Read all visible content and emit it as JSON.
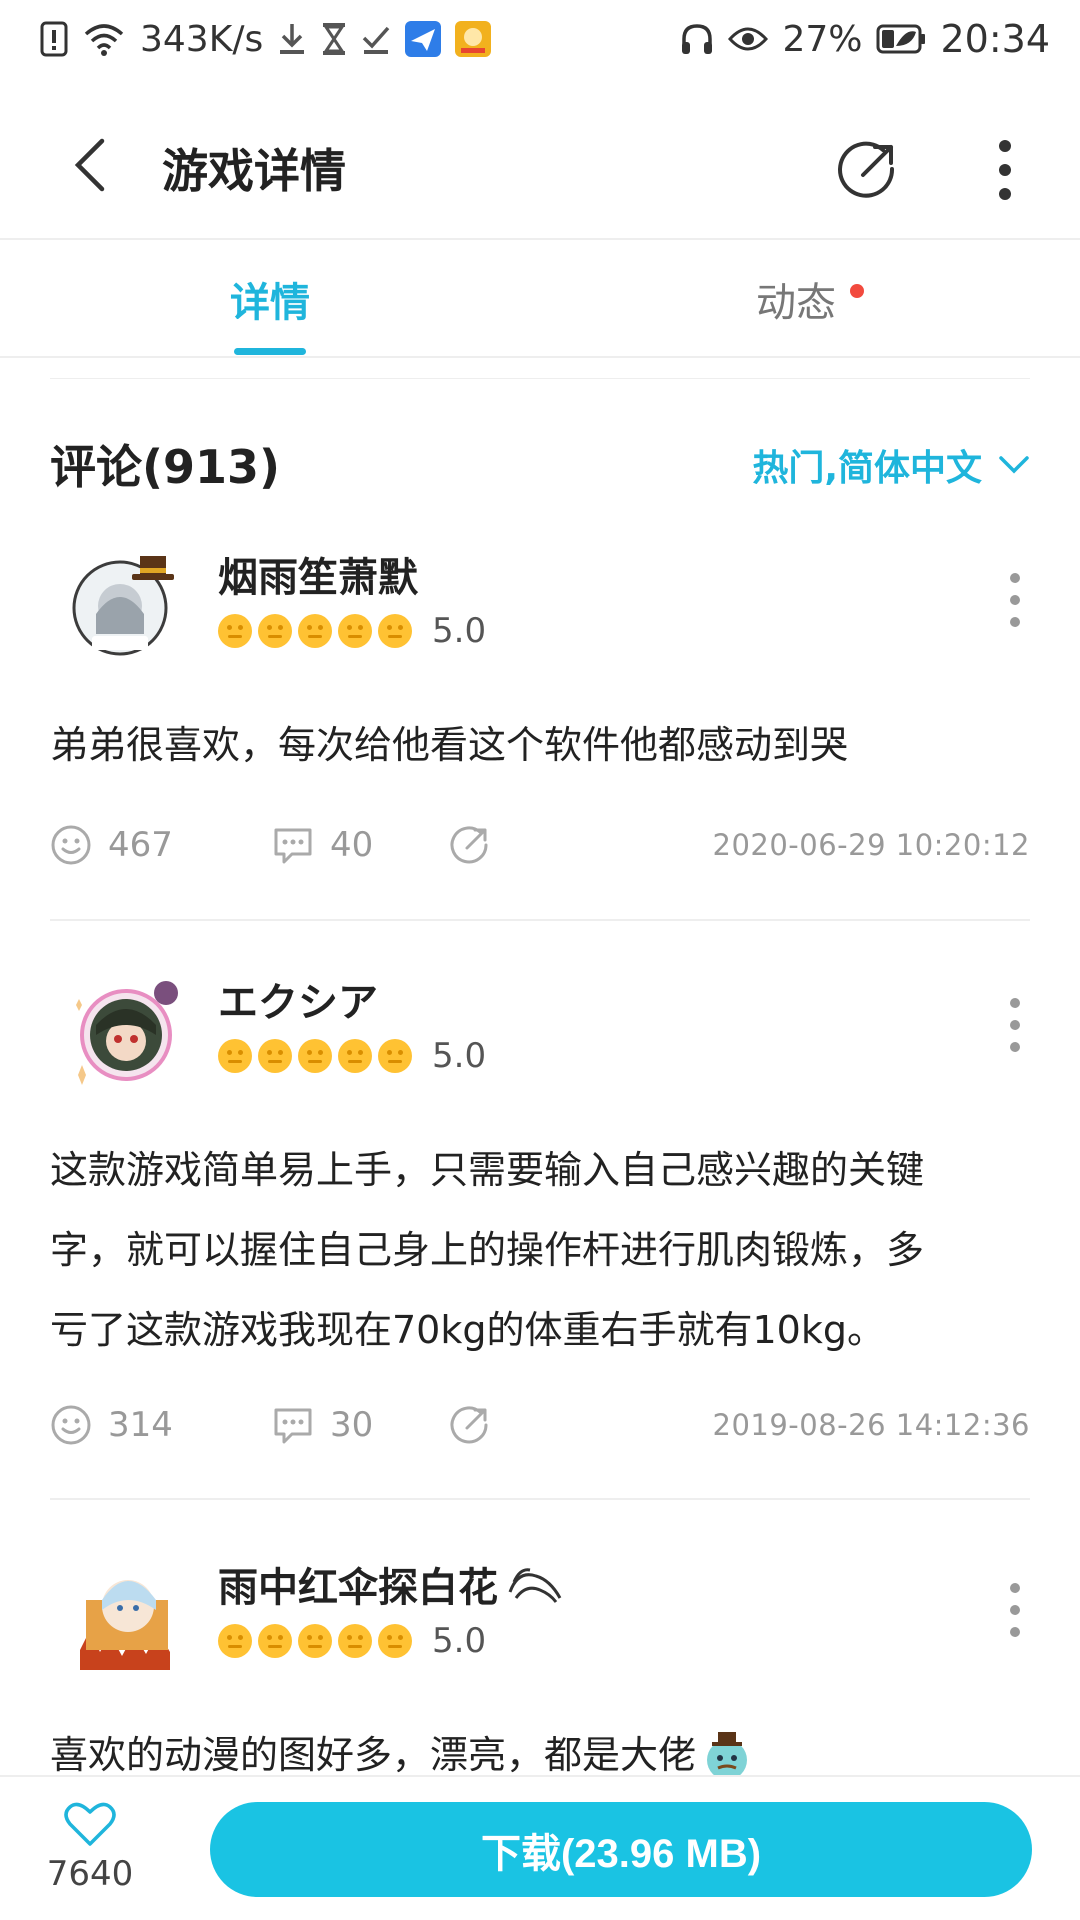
{
  "status_bar": {
    "network_speed": "343K/s",
    "battery": "27%",
    "time": "20:34"
  },
  "header": {
    "title": "游戏详情"
  },
  "tabs": [
    {
      "label": "详情",
      "active": true
    },
    {
      "label": "动态",
      "active": false,
      "has_dot": true
    }
  ],
  "comments": {
    "title": "评论(913)",
    "sort_label": "热门,简体中文",
    "items": [
      {
        "username": "烟雨笙萧默",
        "rating": "5.0",
        "content": [
          "弟弟很喜欢，每次给他看这个软件他都感动到哭"
        ],
        "likes": "467",
        "replies": "40",
        "timestamp": "2020-06-29 10:20:12"
      },
      {
        "username": "エクシア",
        "rating": "5.0",
        "content": [
          "这款游戏简单易上手，只需要输入自己感兴趣的关键",
          "字，就可以握住自己身上的操作杆进行肌肉锻炼，多",
          "亏了这款游戏我现在70kg的体重右手就有10kg。"
        ],
        "likes": "314",
        "replies": "30",
        "timestamp": "2019-08-26 14:12:36"
      },
      {
        "username": "雨中红伞探白花",
        "rating": "5.0",
        "content": [
          "喜欢的动漫的图好多，漂亮，都是大佬"
        ]
      }
    ]
  },
  "bottom_bar": {
    "favorite_count": "7640",
    "download_label": "下载(23.96 MB)"
  },
  "colors": {
    "accent": "#1fb5dc",
    "download_button": "#1ac3e3",
    "star": "#ffc233",
    "notification_dot": "#f24a3e"
  }
}
